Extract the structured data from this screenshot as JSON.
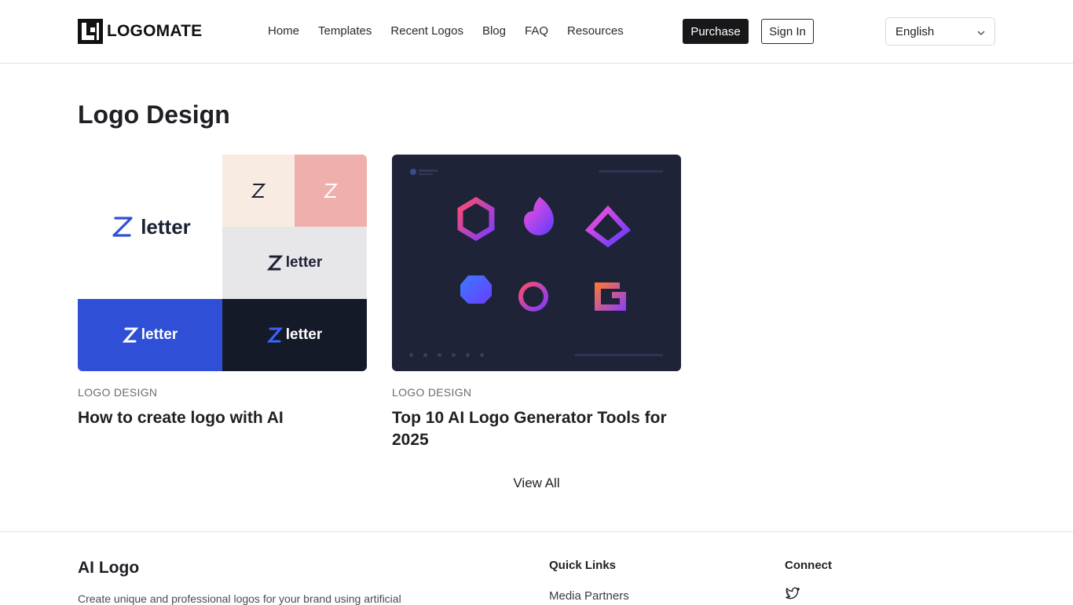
{
  "header": {
    "brand": "LOGOMATE",
    "nav": [
      "Home",
      "Templates",
      "Recent Logos",
      "Blog",
      "FAQ",
      "Resources"
    ],
    "purchase_label": "Purchase",
    "signin_label": "Sign In",
    "language": "English"
  },
  "main": {
    "section_title": "Logo Design",
    "cards": [
      {
        "category": "LOGO DESIGN",
        "title": "How to create logo with AI",
        "image_word": "letter"
      },
      {
        "category": "LOGO DESIGN",
        "title": "Top 10 AI Logo Generator Tools for 2025"
      }
    ],
    "view_all_label": "View All"
  },
  "footer": {
    "brand": "AI Logo",
    "description": "Create unique and professional logos for your brand using artificial",
    "quick_links_title": "Quick Links",
    "quick_links": [
      "Media Partners"
    ],
    "connect_title": "Connect",
    "social_icons": [
      "twitter-icon"
    ]
  },
  "colors": {
    "dark": "#18181b",
    "accent_blue": "#2f4fd6",
    "navy_panel": "#1f2337"
  }
}
